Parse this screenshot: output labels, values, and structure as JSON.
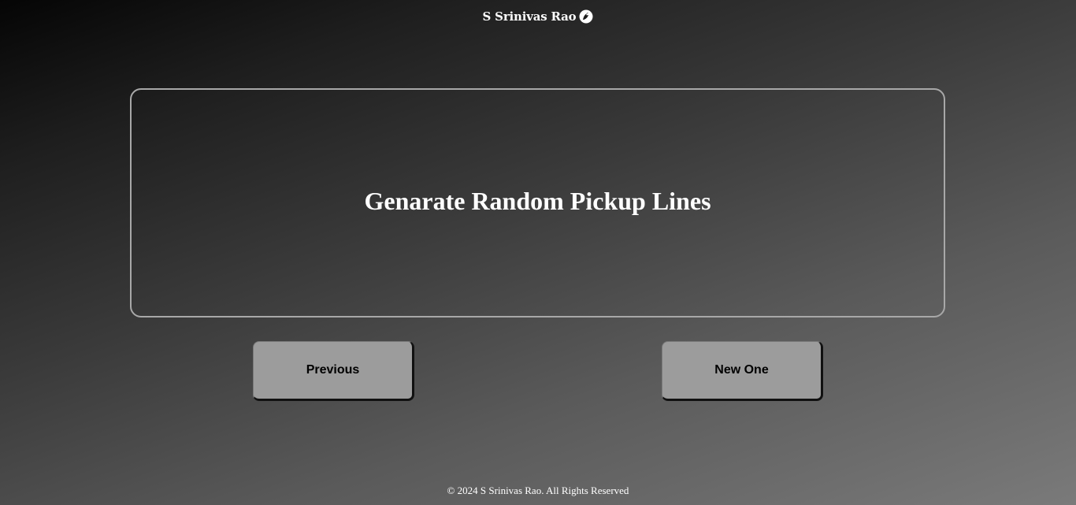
{
  "header": {
    "brand_name": "S Srinivas Rao",
    "logo_icon": "dove-icon"
  },
  "main": {
    "card_text": "Genarate Random Pickup Lines"
  },
  "buttons": {
    "previous_label": "Previous",
    "new_label": "New One"
  },
  "footer": {
    "copyright": "© 2024 S Srinivas Rao. All Rights Reserved"
  },
  "colors": {
    "background_top": "#050505",
    "background_bottom": "#7a7a7a",
    "card_border": "#a8a8a8",
    "button_bg": "#9c9c9c",
    "text": "#ffffff"
  }
}
